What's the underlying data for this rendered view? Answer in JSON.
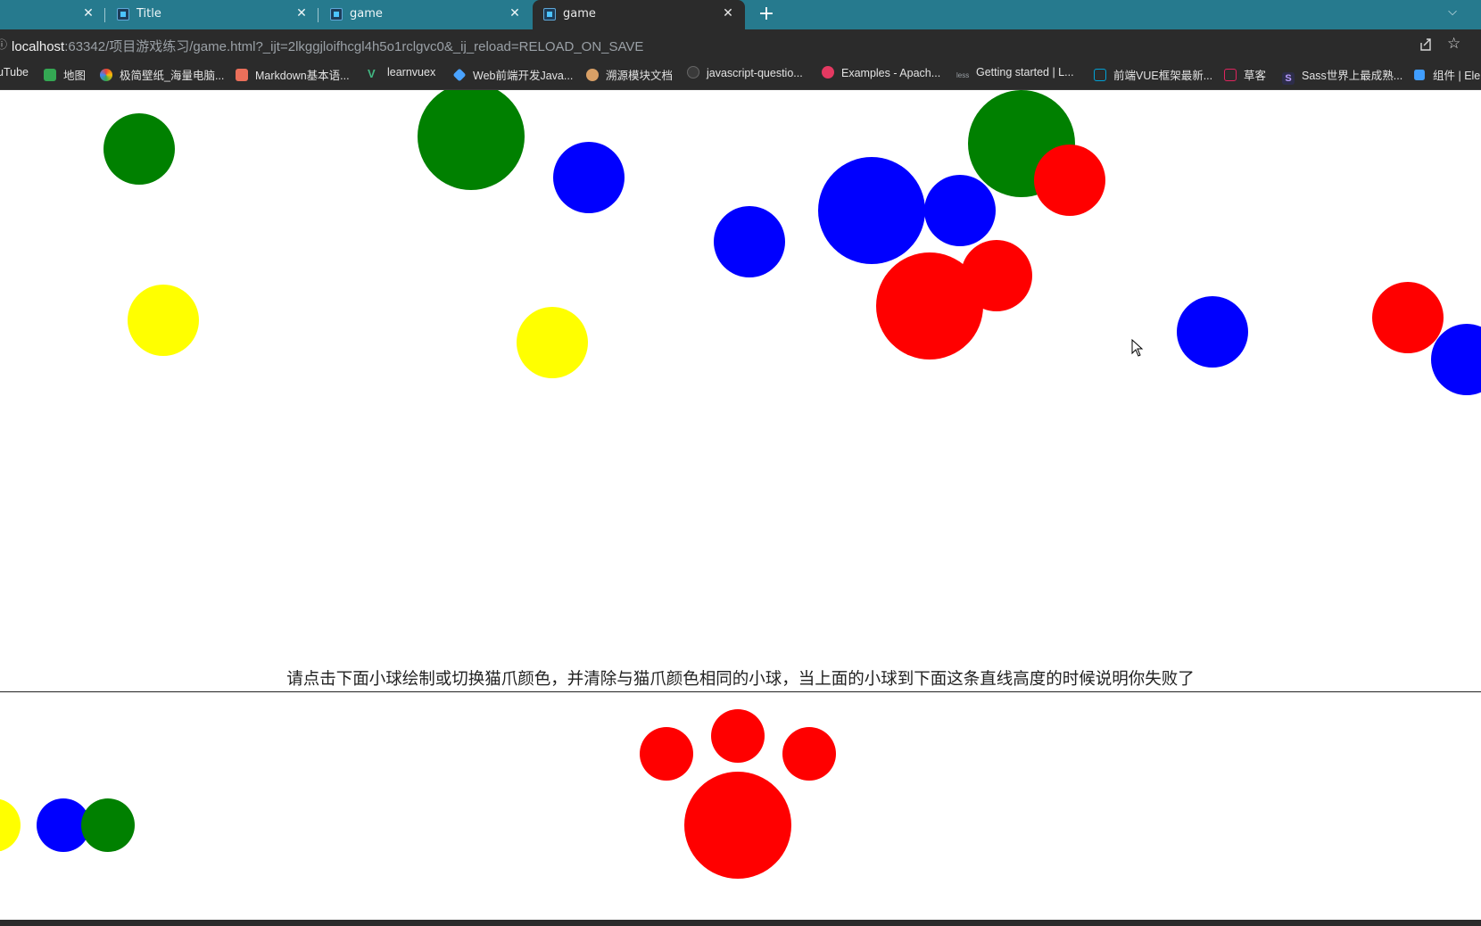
{
  "browser": {
    "tabs": [
      {
        "title": "",
        "active": false
      },
      {
        "title": "Title",
        "active": false
      },
      {
        "title": "game",
        "active": false
      },
      {
        "title": "game",
        "active": true
      }
    ],
    "close_glyph": "✕",
    "new_tab_glyph": "+",
    "tab_menu_glyph": "⌵",
    "address": {
      "info_glyph": "ⓘ",
      "host": "localhost",
      "path": ":63342/项目游戏练习/game.html?_ijt=2lkggjloifhcgl4h5o1rclgvc0&_ij_reload=RELOAD_ON_SAVE"
    },
    "bookmarks": [
      {
        "label": "uTube",
        "icon": "youtube-icon",
        "color": "#ff0000"
      },
      {
        "label": "地图",
        "icon": "maps-icon",
        "color": "#34a853"
      },
      {
        "label": "极简壁纸_海量电脑...",
        "icon": "wallpaper-icon",
        "color": "#f4b400"
      },
      {
        "label": "Markdown基本语...",
        "icon": "jianshu-icon",
        "color": "#ea6f5a"
      },
      {
        "label": "learnvuex",
        "icon": "vue-icon",
        "color": "#42b883"
      },
      {
        "label": "Web前端开发Java...",
        "icon": "diamond-icon",
        "color": "#4aa3ff"
      },
      {
        "label": "溯源模块文档",
        "icon": "doc-icon",
        "color": "#d9a066"
      },
      {
        "label": "javascript-questio...",
        "icon": "github-icon",
        "color": "#777777"
      },
      {
        "label": "Examples - Apach...",
        "icon": "echarts-icon",
        "color": "#e43961"
      },
      {
        "label": "Getting started | L...",
        "icon": "less-icon",
        "color": "#9aa0a6"
      },
      {
        "label": "前端VUE框架最新...",
        "icon": "bilibili-icon",
        "color": "#00a1d6"
      },
      {
        "label": "草客",
        "icon": "mail-icon",
        "color": "#e0245e"
      },
      {
        "label": "Sass世界上最成熟...",
        "icon": "sass-icon",
        "color": "#8e6dd6"
      },
      {
        "label": "组件 | Ele",
        "icon": "element-icon",
        "color": "#409eff"
      }
    ]
  },
  "game": {
    "instruction": "请点击下面小球绘制或切换猫爪颜色，并清除与猫爪颜色相同的小球，当上面的小球到下面这条直线高度的时候说明你失败了",
    "paw_color": "#ff0000",
    "falling_balls": [
      {
        "color": "#008000"
      },
      {
        "color": "#008000"
      },
      {
        "color": "#0000ff"
      },
      {
        "color": "#0000ff"
      },
      {
        "color": "#0000ff"
      },
      {
        "color": "#0000ff"
      },
      {
        "color": "#008000"
      },
      {
        "color": "#ff0000"
      },
      {
        "color": "#ff0000"
      },
      {
        "color": "#ff0000"
      },
      {
        "color": "#ffff00"
      },
      {
        "color": "#ffff00"
      },
      {
        "color": "#0000ff"
      },
      {
        "color": "#ff0000"
      },
      {
        "color": "#0000ff"
      }
    ],
    "palette": [
      {
        "name": "yellow",
        "color": "#ffff00"
      },
      {
        "name": "blue",
        "color": "#0000ff"
      },
      {
        "name": "green",
        "color": "#008000"
      }
    ]
  }
}
